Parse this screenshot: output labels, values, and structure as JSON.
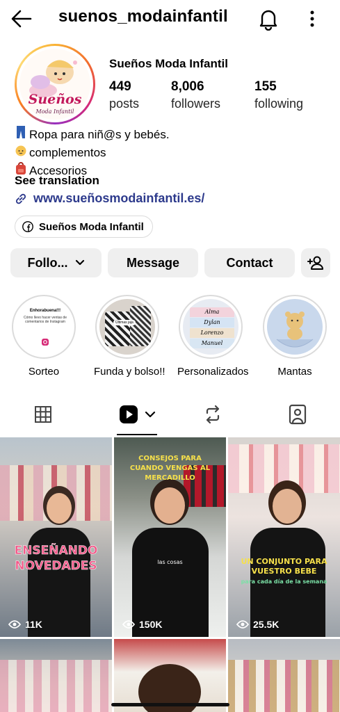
{
  "header": {
    "username": "suenos_modainfantil"
  },
  "profile": {
    "display_name": "Sueños Moda Infantil",
    "avatar_brand": "Sueños",
    "avatar_brand_sub": "Moda Infantil",
    "stats": [
      {
        "value": "449",
        "label": "posts"
      },
      {
        "value": "8,006",
        "label": "followers"
      },
      {
        "value": "155",
        "label": "following"
      }
    ],
    "bio_lines": [
      {
        "emoji": "👖",
        "text": "Ropa para niñ@s y bebés."
      },
      {
        "emoji": "👶",
        "text": "complementos"
      },
      {
        "emoji": "🎒",
        "text": "Accesorios"
      }
    ],
    "see_translation": "See translation",
    "website": "www.sueñosmodainfantil.es/",
    "facebook_chip": "Sueños Moda Infantil"
  },
  "actions": {
    "follow_label": "Follo...",
    "message_label": "Message",
    "contact_label": "Contact"
  },
  "highlights": [
    {
      "label": "Sorteo",
      "cover_title": "Enhorabuena!!!",
      "cover_text": "Cómo llevo hacer ventas de comentarios de Instagram"
    },
    {
      "label": "Funda y bolso!!",
      "cover_title": "Últimas jaja"
    },
    {
      "label": "Personalizados",
      "cover_names": [
        "Alma",
        "Dylan",
        "Lorenzo",
        "Manuel"
      ]
    },
    {
      "label": "Mantas"
    }
  ],
  "tabs": [
    {
      "name": "grid",
      "icon": "grid-icon"
    },
    {
      "name": "reels",
      "icon": "reels-icon"
    },
    {
      "name": "reposts",
      "icon": "repost-icon"
    },
    {
      "name": "tagged",
      "icon": "tagged-icon"
    }
  ],
  "reels": [
    {
      "overlay": "ENSEÑANDO NOVEDADES",
      "caption": "",
      "views": "11K"
    },
    {
      "overlay": "CONSEJOS PARA CUANDO VENGAS AL MERCADILLO",
      "caption": "las cosas",
      "views": "150K"
    },
    {
      "overlay": "UN CONJUNTO PARA VUESTRO BEBE",
      "caption": "para cada día de la semana",
      "views": "25.5K"
    },
    {
      "overlay": "",
      "caption": "",
      "views": ""
    },
    {
      "overlay": "",
      "caption": "",
      "views": ""
    },
    {
      "overlay": "",
      "caption": "",
      "views": ""
    }
  ],
  "colors": {
    "button_bg": "#efefef",
    "link": "#2d3a8c",
    "overlay_pink": "#f25a8a",
    "overlay_green": "#7be0a6",
    "overlay_yellow": "#f6e04a"
  }
}
